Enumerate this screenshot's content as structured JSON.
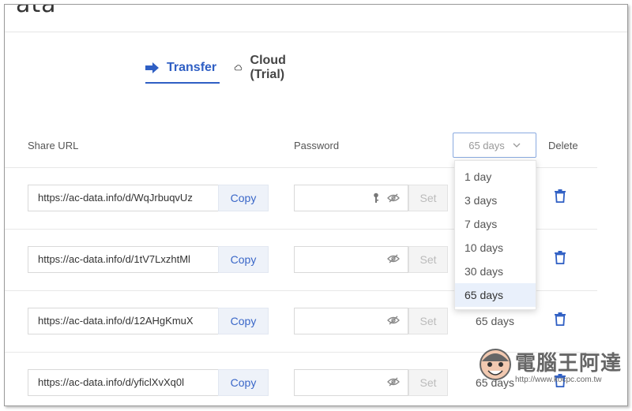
{
  "app": {
    "logo_fragment": "ata"
  },
  "tabs": [
    {
      "label": "Transfer",
      "icon": "arrow-right-icon",
      "active": true
    },
    {
      "label": "Cloud (Trial)",
      "icon": "cloud-icon",
      "active": false
    }
  ],
  "table": {
    "headers": {
      "share_url": "Share URL",
      "password": "Password",
      "delete": "Delete"
    },
    "days_select": {
      "value": "65 days",
      "options": [
        "1 day",
        "3 days",
        "7 days",
        "10 days",
        "30 days",
        "65 days"
      ]
    },
    "rows": [
      {
        "url": "https://ac-data.info/d/WqJrbuqvUz",
        "copy_label": "Copy",
        "set_label": "Set",
        "days": ""
      },
      {
        "url": "https://ac-data.info/d/1tV7LxzhtMl",
        "copy_label": "Copy",
        "set_label": "Set",
        "days": ""
      },
      {
        "url": "https://ac-data.info/d/12AHgKmuX",
        "copy_label": "Copy",
        "set_label": "Set",
        "days": "65 days"
      },
      {
        "url": "https://ac-data.info/d/yficlXvXq0l",
        "copy_label": "Copy",
        "set_label": "Set",
        "days": "65 days"
      }
    ]
  },
  "watermark": {
    "title": "電腦王阿達",
    "url": "http://www.kocpc.com.tw"
  },
  "colors": {
    "accent": "#2f5fc4",
    "selected_bg": "#e9f0fb",
    "copy_bg": "#eef2f9"
  }
}
